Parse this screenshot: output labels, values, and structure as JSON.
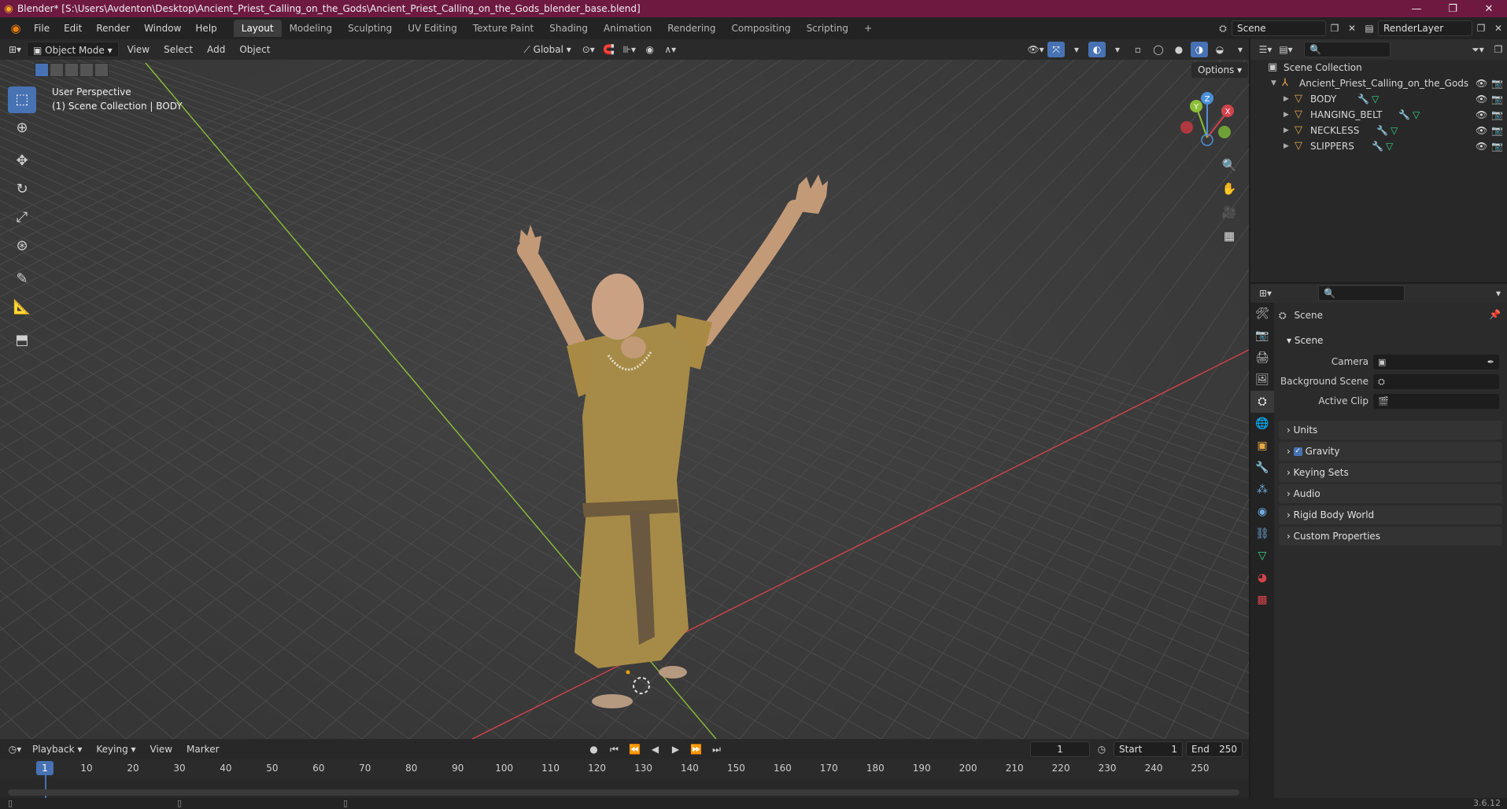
{
  "window": {
    "title": "Blender* [S:\\Users\\Avdenton\\Desktop\\Ancient_Priest_Calling_on_the_Gods\\Ancient_Priest_Calling_on_the_Gods_blender_base.blend]",
    "minimize": "—",
    "maximize": "❐",
    "close": "✕"
  },
  "menu": {
    "items": [
      "File",
      "Edit",
      "Render",
      "Window",
      "Help"
    ],
    "workspaces": [
      "Layout",
      "Modeling",
      "Sculpting",
      "UV Editing",
      "Texture Paint",
      "Shading",
      "Animation",
      "Rendering",
      "Compositing",
      "Scripting"
    ],
    "active_workspace": "Layout",
    "add_workspace": "+",
    "scene": "Scene",
    "render_layer": "RenderLayer"
  },
  "viewport": {
    "mode": "Object Mode",
    "menus": [
      "View",
      "Select",
      "Add",
      "Object"
    ],
    "orientation": "Global",
    "options_label": "Options",
    "perspective_label": "User Perspective",
    "collection_label": "(1) Scene Collection | BODY",
    "gizmo_labels": {
      "x": "X",
      "y": "Y",
      "z": "Z"
    }
  },
  "timeline": {
    "menus": [
      "Playback",
      "Keying",
      "View",
      "Marker"
    ],
    "current_frame": "1",
    "start_label": "Start",
    "start_value": "1",
    "end_label": "End",
    "end_value": "250",
    "ticks": [
      "1",
      "10",
      "20",
      "30",
      "40",
      "50",
      "60",
      "70",
      "80",
      "90",
      "100",
      "110",
      "120",
      "130",
      "140",
      "150",
      "160",
      "170",
      "180",
      "190",
      "200",
      "210",
      "220",
      "230",
      "240",
      "250"
    ]
  },
  "outliner": {
    "root": "Scene Collection",
    "collection": "Ancient_Priest_Calling_on_the_Gods",
    "objects": [
      "BODY",
      "HANGING_BELT",
      "NECKLESS",
      "SLIPPERS"
    ]
  },
  "properties": {
    "context": "Scene",
    "panel_scene": "Scene",
    "rows": [
      {
        "label": "Camera"
      },
      {
        "label": "Background Scene"
      },
      {
        "label": "Active Clip"
      }
    ],
    "panels": [
      "Units",
      "Gravity",
      "Keying Sets",
      "Audio",
      "Rigid Body World",
      "Custom Properties"
    ]
  },
  "status": {
    "version": "3.6.12"
  },
  "colors": {
    "accent": "#4772b3",
    "title_bar": "#6e1a40",
    "x_axis": "#d2434b",
    "y_axis": "#8bbf39",
    "z_axis": "#4a90d9"
  }
}
